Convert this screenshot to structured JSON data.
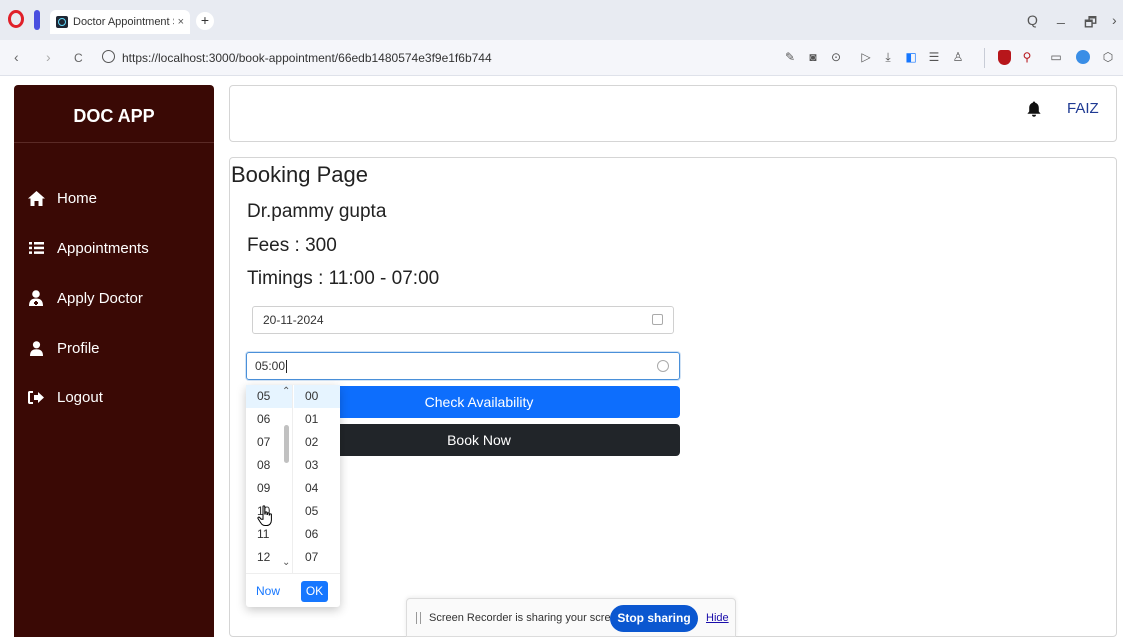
{
  "browser": {
    "tab_title": "Doctor Appointment S",
    "tab_close": "×",
    "new_tab": "+",
    "url": "https://localhost:3000/book-appointment/66edb1480574e3f9e1f6b744",
    "nav": {
      "back": "‹",
      "forward": "›",
      "reload": "C"
    },
    "window_controls": {
      "search": "Q",
      "minimize": "_",
      "restore": "🗗",
      "close": "✕"
    }
  },
  "sidebar": {
    "brand": "DOC APP",
    "items": [
      {
        "label": "Home",
        "icon": "home-icon"
      },
      {
        "label": "Appointments",
        "icon": "list-icon"
      },
      {
        "label": "Apply Doctor",
        "icon": "doctor-icon"
      },
      {
        "label": "Profile",
        "icon": "user-icon"
      },
      {
        "label": "Logout",
        "icon": "logout-icon"
      }
    ],
    "background": "#3a0905"
  },
  "header": {
    "user": "FAIZ",
    "icon": "bell-icon"
  },
  "booking": {
    "title": "Booking Page",
    "doctor": "Dr.pammy gupta",
    "fees": "Fees : 300",
    "timings": "Timings : 11:00 - 07:00",
    "date_value": "20-11-2024",
    "time_value": "05:00",
    "check_button": "Check Availability",
    "book_button": "Book Now",
    "accent": "#0d6efd",
    "dark": "#212529"
  },
  "time_picker": {
    "hours": [
      "05",
      "06",
      "07",
      "08",
      "09",
      "10",
      "11",
      "12"
    ],
    "minutes": [
      "00",
      "01",
      "02",
      "03",
      "04",
      "05",
      "06",
      "07"
    ],
    "now_label": "Now",
    "ok_label": "OK"
  },
  "screen_recorder": {
    "message": "Screen Recorder is sharing your screen.",
    "stop_label": "Stop sharing",
    "hide_label": "Hide"
  }
}
